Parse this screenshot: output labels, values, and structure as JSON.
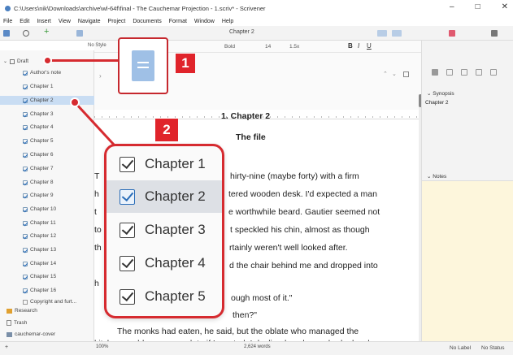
{
  "window": {
    "title": "C:\\Users\\nik\\Downloads\\archive\\wl-64f\\final - The Cauchemar Projection - 1.scriv* - Scrivener",
    "controls": [
      "–",
      "□",
      "✕"
    ]
  },
  "menu": [
    "File",
    "Edit",
    "Insert",
    "View",
    "Navigate",
    "Project",
    "Documents",
    "Format",
    "Window",
    "Help"
  ],
  "toolbar": {
    "doc_title": "Chapter 2",
    "style": "No Style",
    "font_weight": "Bold",
    "font_size": "14",
    "line_spacing": "1.5x"
  },
  "binder": {
    "root": "Draft",
    "items": [
      "Author's note",
      "Chapter 1",
      "Chapter 2",
      "Chapter 3",
      "Chapter 4",
      "Chapter 5",
      "Chapter 6",
      "Chapter 7",
      "Chapter 8",
      "Chapter 9",
      "Chapter 10",
      "Chapter 11",
      "Chapter 12",
      "Chapter 13",
      "Chapter 14",
      "Chapter 15",
      "Chapter 16",
      "Copyright and furt..."
    ],
    "selected_index": 2,
    "research": "Research",
    "trash": "Trash",
    "extra": "cauchemar-cover"
  },
  "editor": {
    "heading": "1.  Chapter 2",
    "subheading": "The file",
    "lines": [
      "hirty-nine (maybe forty) with a firm",
      "tered wooden desk. I'd expected a man",
      "e worthwhile beard. Gautier seemed not",
      "t speckled his chin, almost as though",
      "rtainly weren't well looked after.",
      "d the chair behind me and dropped into",
      "ough most of it.\"",
      "then?\"",
      "The monks had eaten, he said, but the oblate who managed the",
      "kitchen could prepare a plate if I wanted. I declined, so he pushed a bowl"
    ],
    "left_fragments": [
      "T",
      "h",
      "t",
      "to",
      "th",
      "h"
    ]
  },
  "inspector": {
    "synopsis_label": "Synopsis",
    "synopsis_title": "Chapter 2",
    "notes_label": "Notes"
  },
  "statusbar": {
    "zoom": "100%",
    "words": "2,624 words",
    "label": "No Label",
    "status": "No Status"
  },
  "callout": {
    "badge1": "1",
    "badge2": "2",
    "chapters": [
      "Chapter 1",
      "Chapter 2",
      "Chapter 3",
      "Chapter 4",
      "Chapter 5"
    ],
    "selected": 1
  },
  "colors": {
    "accent_red": "#e0242b",
    "selection_blue": "#c9ddf3",
    "notes_bg": "#fdf6dc"
  }
}
